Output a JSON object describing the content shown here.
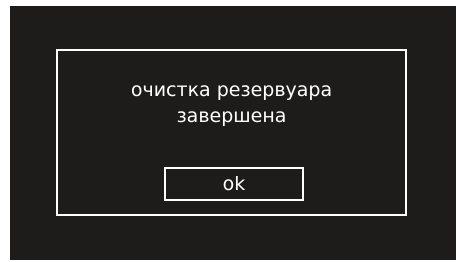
{
  "colors": {
    "screen_background": "#1e1b1b",
    "foreground": "#ffffff"
  },
  "dialog": {
    "message_line1": "очистка резервуара",
    "message_line2": "завершена",
    "ok_label": "ok"
  }
}
